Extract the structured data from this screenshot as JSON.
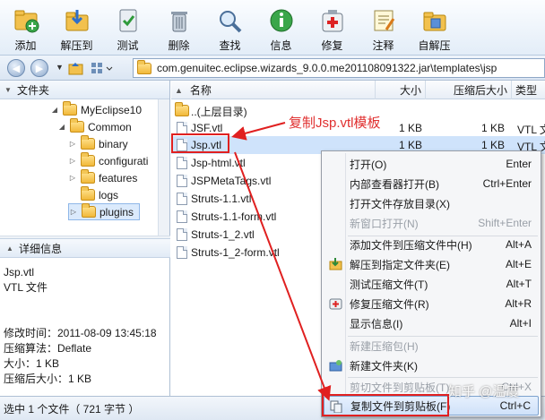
{
  "toolbar": {
    "buttons": [
      {
        "label": "添加",
        "icon": "add-icon"
      },
      {
        "label": "解压到",
        "icon": "extract-icon"
      },
      {
        "label": "测试",
        "icon": "test-icon"
      },
      {
        "label": "删除",
        "icon": "delete-icon"
      },
      {
        "label": "查找",
        "icon": "find-icon"
      },
      {
        "label": "信息",
        "icon": "info-icon"
      },
      {
        "label": "修复",
        "icon": "repair-icon"
      },
      {
        "label": "注释",
        "icon": "comment-icon"
      },
      {
        "label": "自解压",
        "icon": "sfx-icon"
      }
    ]
  },
  "address": {
    "path": "com.genuitec.eclipse.wizards_9.0.0.me201108091322.jar\\templates\\jsp"
  },
  "left_panel": {
    "header": "文件夹",
    "tree": [
      {
        "label": "MyEclipse10"
      },
      {
        "label": "Common"
      },
      {
        "label": "binary"
      },
      {
        "label": "configurati"
      },
      {
        "label": "features"
      },
      {
        "label": "logs"
      },
      {
        "label": "plugins"
      }
    ],
    "details_header": "详细信息",
    "details": {
      "name": "Jsp.vtl",
      "type": "VTL 文件",
      "modified": "修改时间：2011-08-09 13:45:18",
      "method": "压缩算法：Deflate",
      "size": "大小：1 KB",
      "packed": "压缩后大小：1 KB"
    }
  },
  "columns": {
    "name": "名称",
    "size": "大小",
    "packed": "压缩后大小",
    "type": "类型"
  },
  "files": [
    {
      "name": "..(上层目录)",
      "size": "",
      "packed": "",
      "type": ""
    },
    {
      "name": "JSF.vtl",
      "size": "1 KB",
      "packed": "1 KB",
      "type": "VTL 文"
    },
    {
      "name": "Jsp.vtl",
      "size": "1 KB",
      "packed": "1 KB",
      "type": "VTL 文"
    },
    {
      "name": "Jsp-html.vtl",
      "size": "",
      "packed": "",
      "type": ""
    },
    {
      "name": "JSPMetaTags.vtl",
      "size": "",
      "packed": "",
      "type": ""
    },
    {
      "name": "Struts-1.1.vtl",
      "size": "",
      "packed": "",
      "type": ""
    },
    {
      "name": "Struts-1.1-form.vtl",
      "size": "",
      "packed": "",
      "type": ""
    },
    {
      "name": "Struts-1_2.vtl",
      "size": "",
      "packed": "",
      "type": ""
    },
    {
      "name": "Struts-1_2-form.vtl",
      "size": "",
      "packed": "",
      "type": ""
    }
  ],
  "annotation": "复制Jsp.vtl模板",
  "context_menu": [
    {
      "label": "打开(O)",
      "shortcut": "Enter",
      "disabled": false
    },
    {
      "label": "内部查看器打开(B)",
      "shortcut": "Ctrl+Enter",
      "disabled": false
    },
    {
      "label": "打开文件存放目录(X)",
      "shortcut": "",
      "disabled": false
    },
    {
      "label": "新窗口打开(N)",
      "shortcut": "Shift+Enter",
      "disabled": true
    },
    {
      "label": "添加文件到压缩文件中(H)",
      "shortcut": "Alt+A",
      "disabled": false
    },
    {
      "label": "解压到指定文件夹(E)",
      "shortcut": "Alt+E",
      "disabled": false
    },
    {
      "label": "测试压缩文件(T)",
      "shortcut": "Alt+T",
      "disabled": false
    },
    {
      "label": "修复压缩文件(R)",
      "shortcut": "Alt+R",
      "disabled": false
    },
    {
      "label": "显示信息(I)",
      "shortcut": "Alt+I",
      "disabled": false
    },
    {
      "label": "新建压缩包(H)",
      "shortcut": "",
      "disabled": true
    },
    {
      "label": "新建文件夹(K)",
      "shortcut": "",
      "disabled": false
    },
    {
      "label": "剪切文件到剪贴板(T)",
      "shortcut": "Ctrl+X",
      "disabled": true
    },
    {
      "label": "复制文件到剪贴板(F)",
      "shortcut": "Ctrl+C",
      "disabled": false
    }
  ],
  "status": "选中 1 个文件（ 721 字节 ）",
  "watermark": "知乎 @温度",
  "colors": {
    "accent_red": "#e02020",
    "selection": "#cfe3fb"
  }
}
